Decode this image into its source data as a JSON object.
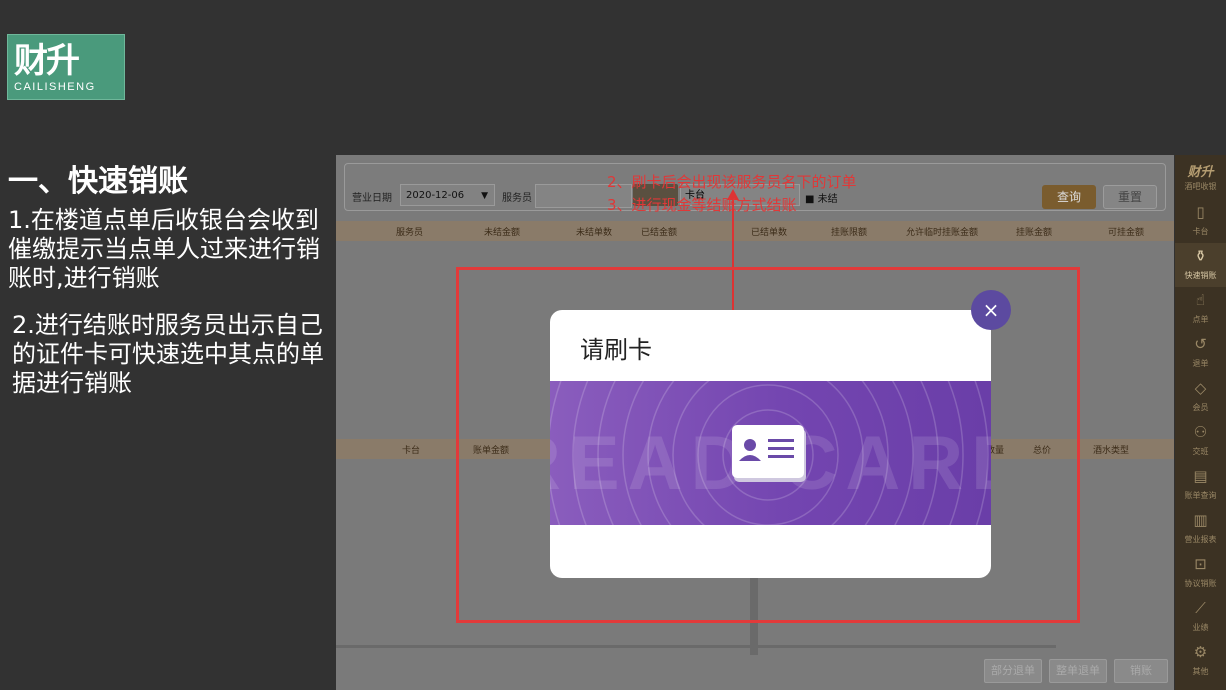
{
  "logo": {
    "cn": "财升",
    "en": "CAILISHENG"
  },
  "section_title": "一、快速销账",
  "notes": [
    "1.在楼道点单后收银台会收到催缴提示当点单人过来进行销账时,进行销账",
    "2.进行结账时服务员出示自己的证件卡可快速选中其点的单据进行销账"
  ],
  "annotations": [
    "2、刷卡后会出现该服务员名下的订单",
    "3、进行现金等结账方式结账"
  ],
  "filter": {
    "date_label": "营业日期",
    "date_value": "2020-12-06",
    "waiter_label": "服务员",
    "card_label": "卡台",
    "checkbox_label": "未结",
    "query_button": "查询",
    "reset_button": "重置"
  },
  "top_table_headers": [
    "服务员",
    "未结金额",
    "未结单数",
    "已结金额",
    "已结单数",
    "挂账限额",
    "允许临时挂账金额",
    "挂账金额",
    "可挂金额"
  ],
  "bottom_table_headers": [
    "卡台",
    "账单金额",
    "数量",
    "总价",
    "酒水类型"
  ],
  "bottom_buttons": [
    "部分退单",
    "整单退单",
    "销账"
  ],
  "dialog": {
    "title": "请刷卡",
    "close": "×",
    "watermark": "READ CARD"
  },
  "sidebar": {
    "brand": "财升",
    "subtitle": "酒吧收银",
    "items": [
      {
        "label": "卡台",
        "icon": "table-card-icon"
      },
      {
        "label": "快速销账",
        "icon": "quick-writeoff-icon",
        "active": true
      },
      {
        "label": "点单",
        "icon": "hand-order-icon"
      },
      {
        "label": "退单",
        "icon": "refund-icon"
      },
      {
        "label": "会员",
        "icon": "diamond-member-icon"
      },
      {
        "label": "交班",
        "icon": "handover-icon"
      },
      {
        "label": "账单查询",
        "icon": "bill-query-icon"
      },
      {
        "label": "营业报表",
        "icon": "report-icon"
      },
      {
        "label": "协议销账",
        "icon": "agreement-icon"
      },
      {
        "label": "业绩",
        "icon": "chart-icon"
      },
      {
        "label": "其他",
        "icon": "gear-icon"
      }
    ]
  },
  "colors": {
    "highlight": "#e23a3a",
    "dialog_band": "#7345b0",
    "sidebar": "#3c3223"
  }
}
